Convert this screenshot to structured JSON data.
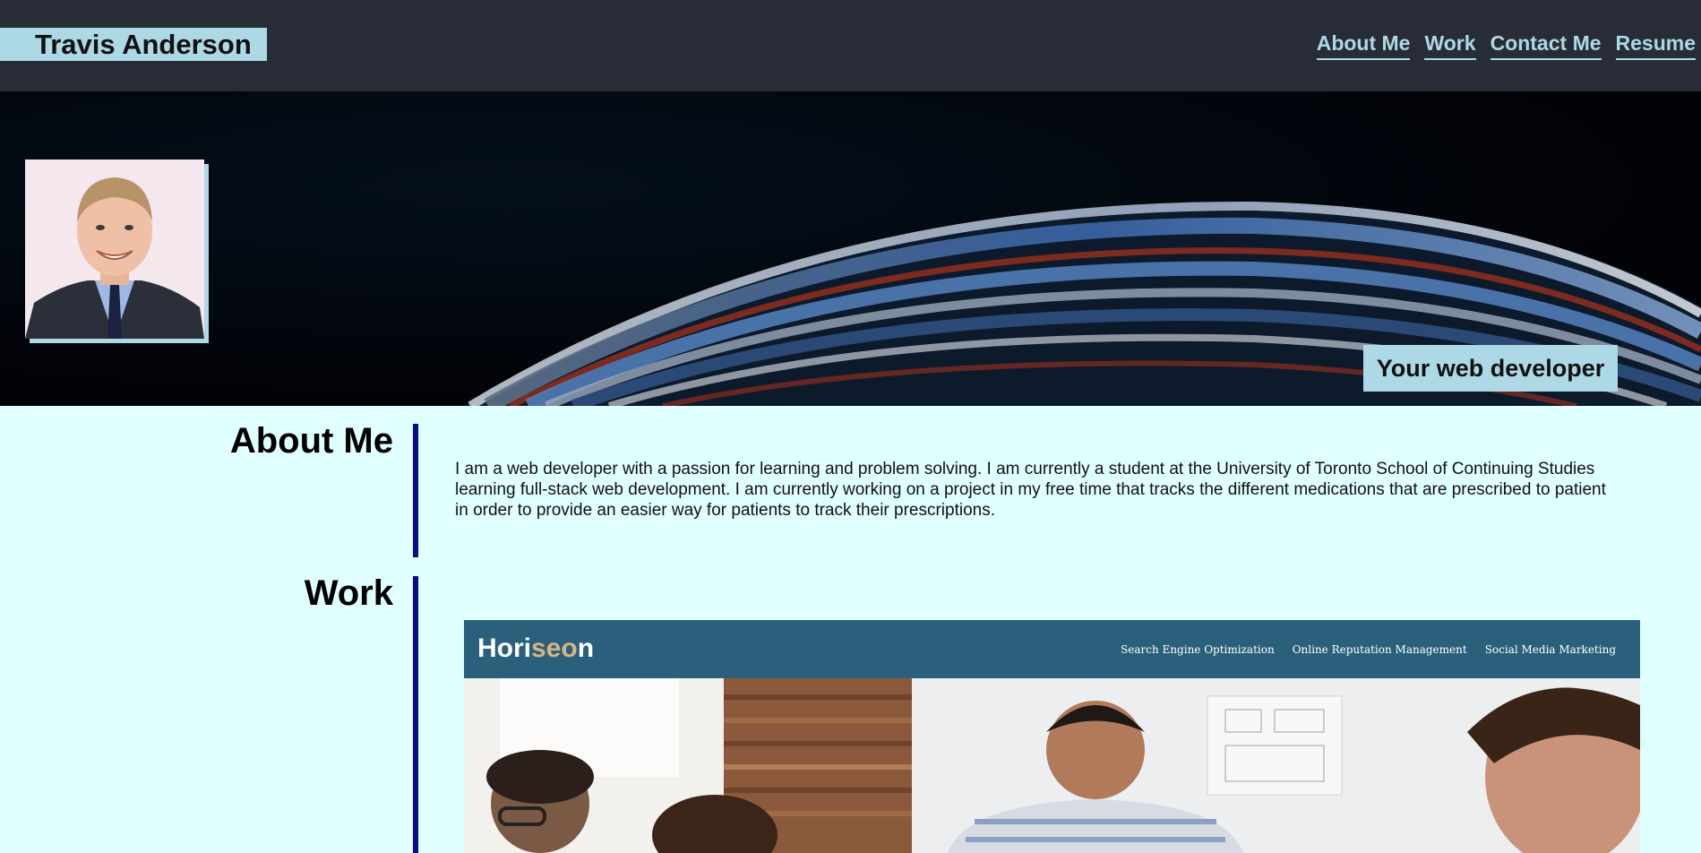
{
  "header": {
    "name": "Travis Anderson",
    "nav": [
      {
        "label": "About Me"
      },
      {
        "label": "Work"
      },
      {
        "label": "Contact Me"
      },
      {
        "label": "Resume"
      }
    ]
  },
  "hero": {
    "tagline": "Your web developer"
  },
  "about": {
    "title": "About Me",
    "text": "I am a web developer with a passion for learning and problem solving. I am currently a student at the University of Toronto School of Continuing Studies learning full-stack web development. I am currently working on a project in my free time that tracks the different medications that are prescribed to patient in order to provide an easier way for patients to track their prescriptions."
  },
  "work": {
    "title": "Work",
    "project": {
      "logo_part1": "Hori",
      "logo_part2": "seo",
      "logo_part3": "n",
      "nav": [
        "Search Engine Optimization",
        "Online Reputation Management",
        "Social Media Marketing"
      ]
    }
  },
  "colors": {
    "header_bg": "#282c37",
    "accent": "#add8e6",
    "page_bg": "#e0ffff",
    "rule": "#0b0b8f",
    "project_header": "#2a607c"
  }
}
